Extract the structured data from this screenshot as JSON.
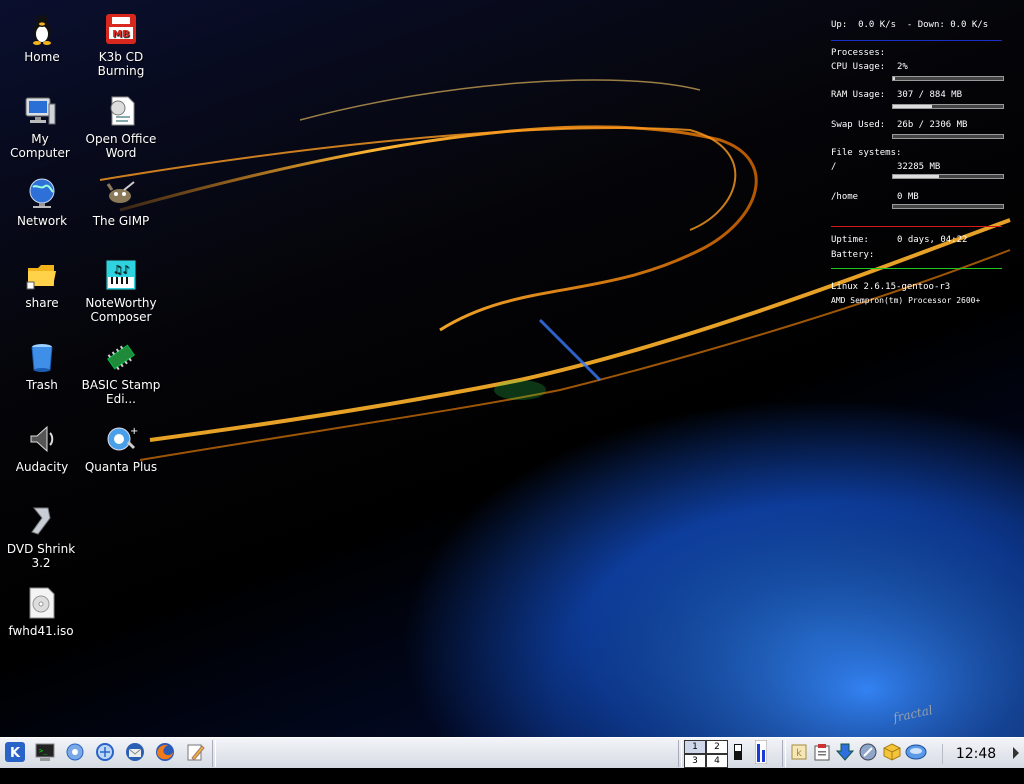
{
  "desktop": {
    "icons": [
      {
        "label": "Home",
        "icon": "tux-home-icon"
      },
      {
        "label": "K3b CD Burning",
        "icon": "k3b-icon"
      },
      {
        "label": "My Computer",
        "icon": "computer-icon"
      },
      {
        "label": "Open Office Word",
        "icon": "openoffice-writer-icon"
      },
      {
        "label": "Network",
        "icon": "network-globe-icon"
      },
      {
        "label": "The GIMP",
        "icon": "gimp-icon"
      },
      {
        "label": "share",
        "icon": "folder-icon"
      },
      {
        "label": "NoteWorthy Composer",
        "icon": "noteworthy-icon"
      },
      {
        "label": "Trash",
        "icon": "trash-icon"
      },
      {
        "label": "BASIC Stamp Edi...",
        "icon": "chip-icon"
      },
      {
        "label": "Audacity",
        "icon": "audacity-icon"
      },
      {
        "label": "Quanta Plus",
        "icon": "quanta-icon"
      },
      {
        "label": "DVD Shrink 3.2",
        "icon": "dvd-shrink-icon"
      },
      {
        "label": "fwhd41.iso",
        "icon": "iso-file-icon"
      }
    ]
  },
  "sysmon": {
    "net": "Up:  0.0 K/s  - Down: 0.0 K/s",
    "processes": "Processes:",
    "cpu_label": "CPU Usage:",
    "cpu_value": "2%",
    "cpu_fraction": 0.02,
    "ram_label": "RAM Usage:",
    "ram_value": "307 / 884 MB",
    "ram_fraction": 0.35,
    "swap_label": "Swap Used:",
    "swap_value": "26b / 2306 MB",
    "swap_fraction": 0.0,
    "fs_label": "File systems:",
    "fs_root_label": "/",
    "fs_root_value": "32285 MB",
    "fs_root_fraction": 0.42,
    "fs_home_label": "/home",
    "fs_home_value": "0 MB",
    "fs_home_fraction": 0.0,
    "uptime_label": "Uptime:",
    "uptime_value": "0 days, 04:22",
    "battery_label": "Battery:",
    "kernel": "Linux 2.6.15-gentoo-r3",
    "cpu_model": "AMD Sempron(tm) Processor 2600+",
    "colors": {
      "net_rule": "#1a2ec8",
      "uptime_rule": "#d21a1a",
      "battery_rule": "#1ec81e"
    }
  },
  "taskbar": {
    "launchers": [
      "kde-menu-icon",
      "konsole-icon",
      "kde-control-icon",
      "konqueror-icon",
      "thunderbird-icon",
      "firefox-icon",
      "kwrite-icon"
    ],
    "pager": [
      "1",
      "2",
      "3",
      "4"
    ],
    "tray": [
      "kopete-icon",
      "klipper-icon",
      "download-icon",
      "network-monitor-icon",
      "package-icon",
      "volume-icon"
    ],
    "clock": "12:48 pm"
  },
  "wallpaper_signature": "fractal"
}
